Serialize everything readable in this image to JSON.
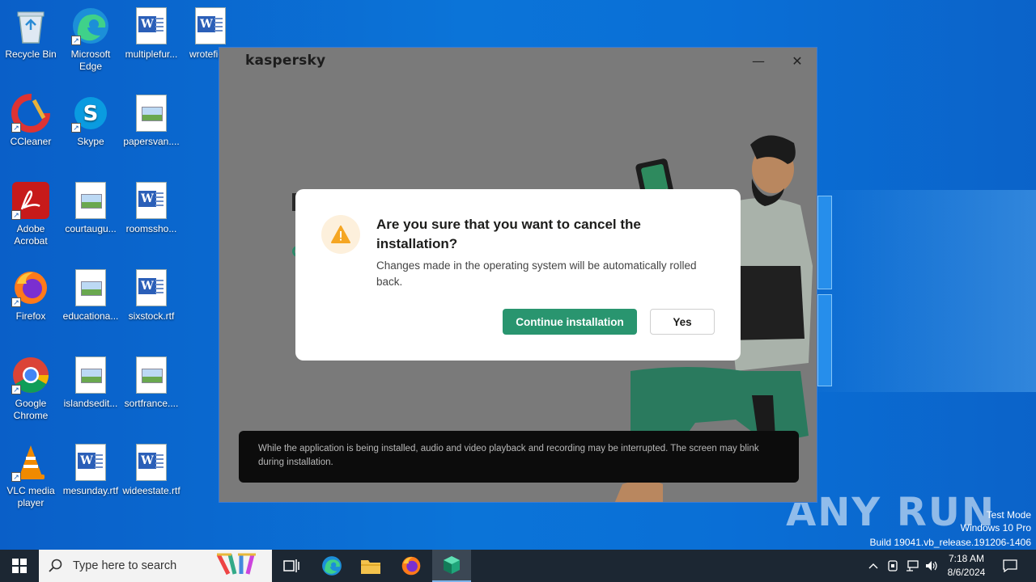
{
  "desktop": {
    "icons": [
      {
        "label": "Recycle Bin"
      },
      {
        "label": "Microsoft Edge"
      },
      {
        "label": "multiplefur..."
      },
      {
        "label": "wrotefig..."
      },
      {
        "label": "CCleaner"
      },
      {
        "label": "Skype"
      },
      {
        "label": "papersvan...."
      },
      {
        "label": "Adobe Acrobat"
      },
      {
        "label": "courtaugu..."
      },
      {
        "label": "roomssho..."
      },
      {
        "label": "Firefox"
      },
      {
        "label": "educationa..."
      },
      {
        "label": "sixstock.rtf"
      },
      {
        "label": "Google Chrome"
      },
      {
        "label": "islandsedit..."
      },
      {
        "label": "sortfrance...."
      },
      {
        "label": "VLC media player"
      },
      {
        "label": "mesunday.rtf"
      },
      {
        "label": "wideestate.rtf"
      }
    ],
    "watermark": "ANY RUN",
    "test_mode": "Test Mode",
    "os_edition": "Windows 10 Pro",
    "build": "Build 19041.vb_release.191206-1406"
  },
  "installer": {
    "brand": "kaspersky",
    "minimize_glyph": "—",
    "close_glyph": "✕",
    "notice": "While the application is being installed, audio and video playback and recording may be interrupted. The screen may blink during installation."
  },
  "dialog": {
    "title": "Are you sure that you want to cancel the installation?",
    "message": "Changes made in the operating system will be automatically rolled back.",
    "continue_label": "Continue installation",
    "yes_label": "Yes",
    "warning_color": "#f5a623",
    "accent_color": "#29956f"
  },
  "taskbar": {
    "search_placeholder": "Type here to search",
    "time": "7:18 AM",
    "date": "8/6/2024"
  }
}
